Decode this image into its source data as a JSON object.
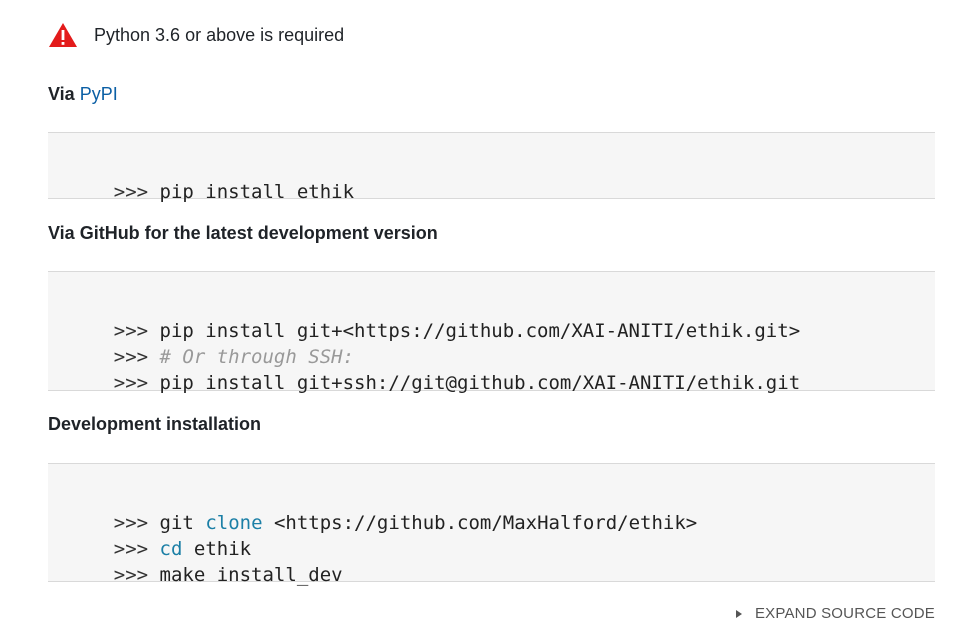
{
  "warning": {
    "icon": "warning-icon",
    "icon_color": "#e31b1b",
    "text": "Python 3.6 or above is required"
  },
  "sections": [
    {
      "heading_prefix": "Via",
      "heading_link": "PyPI",
      "lines": [
        {
          "prompt": ">>>",
          "text": "pip install ethik"
        }
      ]
    },
    {
      "heading": "Via GitHub for the latest development version",
      "lines": [
        {
          "prompt": ">>>",
          "text": "pip install git+<https://github.com/XAI-ANITI/ethik.git>"
        },
        {
          "prompt": ">>>",
          "comment": "# Or through SSH:"
        },
        {
          "prompt": ">>>",
          "text": "pip install git+ssh://git@github.com/XAI-ANITI/ethik.git"
        }
      ]
    },
    {
      "heading": "Development installation",
      "lines": [
        {
          "prompt": ">>>",
          "pre": "git",
          "kw": "clone",
          "text": "<https://github.com/MaxHalford/ethik>"
        },
        {
          "prompt": ">>>",
          "kw": "cd",
          "text": "ethik"
        },
        {
          "prompt": ">>>",
          "text": "make install_dev"
        }
      ]
    }
  ],
  "expand_label": "EXPAND SOURCE CODE",
  "colors": {
    "link": "#0b5fa5",
    "keyword": "#1b7fa6",
    "code_bg": "#f6f6f6"
  }
}
